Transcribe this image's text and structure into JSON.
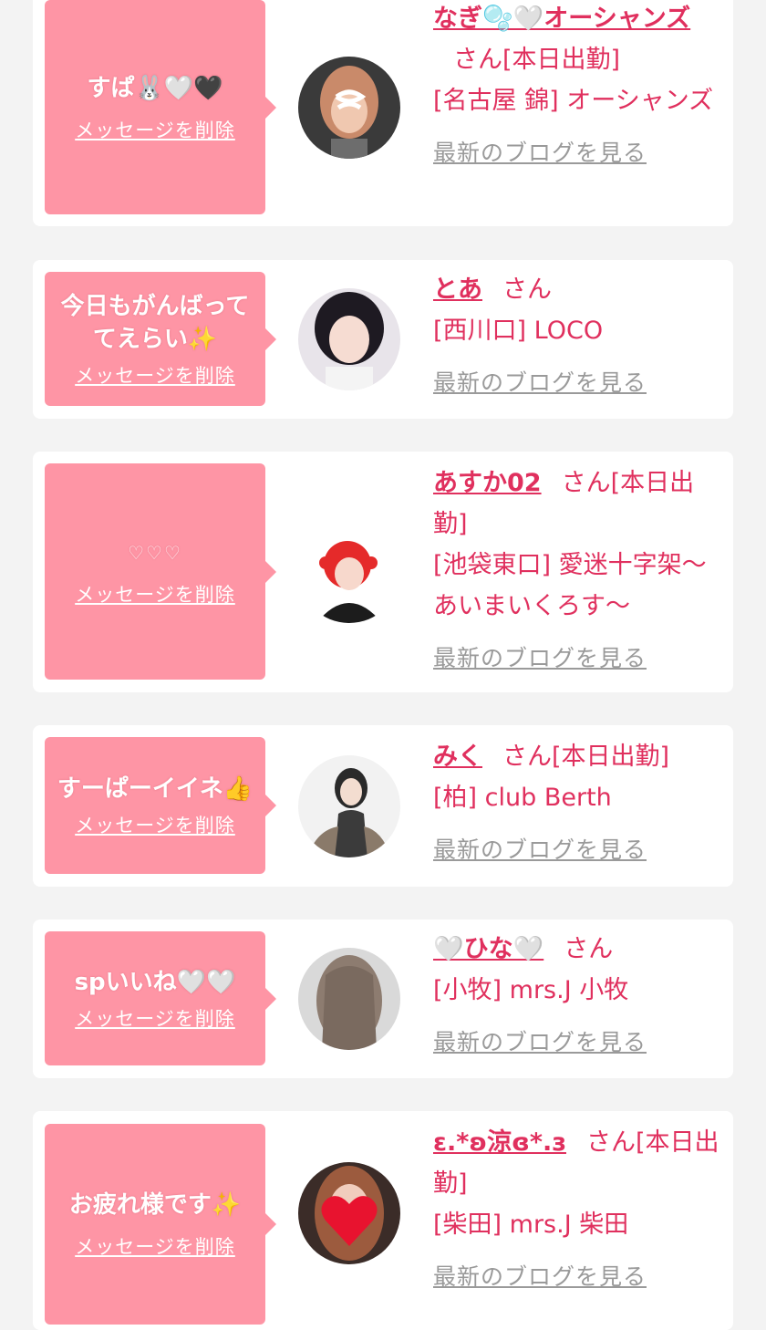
{
  "entries": [
    {
      "message": "すぱ🐰🤍🖤",
      "delete_label": "メッセージを削除",
      "name": "なぎ🫧🤍オーシャンズ",
      "suffix": "さん",
      "status": "[本日出勤]",
      "shop": "[名古屋 錦] オーシャンズ",
      "blog_label": "最新のブログを見る"
    },
    {
      "message": "今日もがんばっててえらい✨",
      "delete_label": "メッセージを削除",
      "name": "とあ",
      "suffix": "さん",
      "status": "",
      "shop": "[西川口] LOCO",
      "blog_label": "最新のブログを見る"
    },
    {
      "message": "♡♡♡",
      "delete_label": "メッセージを削除",
      "name": "あすか02",
      "suffix": "さん",
      "status": "[本日出勤]",
      "shop": "[池袋東口] 愛迷十字架〜あいまいくろす〜",
      "blog_label": "最新のブログを見る"
    },
    {
      "message": "すーぱーイイネ👍",
      "delete_label": "メッセージを削除",
      "name": "みく",
      "suffix": "さん",
      "status": "[本日出勤]",
      "shop": "[柏] club Berth",
      "blog_label": "最新のブログを見る"
    },
    {
      "message": "spいいね🤍🤍",
      "delete_label": "メッセージを削除",
      "name": "🤍ひな🤍",
      "suffix": "さん",
      "status": "",
      "shop": "[小牧] mrs.J 小牧",
      "blog_label": "最新のブログを見る"
    },
    {
      "message": "お疲れ様です✨",
      "delete_label": "メッセージを削除",
      "name": "ε.*ʚ涼ɞ*.з",
      "suffix": "さん",
      "status": "[本日出勤]",
      "shop": "[柴田] mrs.J 柴田",
      "blog_label": "最新のブログを見る"
    }
  ],
  "colors": {
    "accent": "#e0305e",
    "message_bg": "#fe95a5",
    "link_gray": "#9a9a9a",
    "page_bg": "#f3f3f3"
  }
}
